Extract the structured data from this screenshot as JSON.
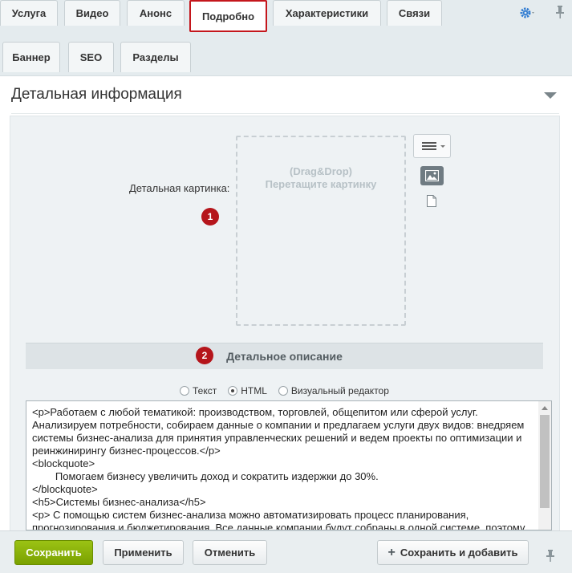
{
  "tabs": [
    {
      "label": "Услуга",
      "active": false
    },
    {
      "label": "Видео",
      "active": false
    },
    {
      "label": "Анонс",
      "active": false
    },
    {
      "label": "Подробно",
      "active": true
    },
    {
      "label": "Характеристики",
      "active": false
    },
    {
      "label": "Связи",
      "active": false
    }
  ],
  "subtabs": [
    {
      "label": "Баннер"
    },
    {
      "label": "SEO"
    },
    {
      "label": "Разделы"
    }
  ],
  "section": {
    "title": "Детальная информация"
  },
  "picture_field": {
    "label": "Детальная картинка:",
    "drop_line1": "(Drag&Drop)",
    "drop_line2": "Перетащите картинку"
  },
  "badges": {
    "one": "1",
    "two": "2"
  },
  "description": {
    "title": "Детальное описание",
    "modes": [
      {
        "label": "Текст",
        "checked": false
      },
      {
        "label": "HTML",
        "checked": true
      },
      {
        "label": "Визуальный редактор",
        "checked": false
      }
    ],
    "content": "<p>Работаем с любой тематикой: производством, торговлей, общепитом или сферой услуг. Анализируем потребности, собираем данные о компании и предлагаем услуги двух видов: внедряем системы бизнес-анализа для принятия управленческих решений и ведем проекты по оптимизации и реинжинирингу бизнес-процессов.</p>\n<blockquote>\n        Помогаем бизнесу увеличить доход и сократить издержки до 30%.\n</blockquote>\n<h5>Системы бизнес-анализа</h5>\n<p> С помощью систем бизнес-анализа можно автоматизировать процесс планирования, прогнозирования и бюджетирования. Все данные компании будут собраны в одной системе, поэтому"
  },
  "footer": {
    "save": "Сохранить",
    "apply": "Применить",
    "cancel": "Отменить",
    "save_add": "Сохранить и добавить"
  },
  "colors": {
    "accent_red": "#c4161c",
    "save_green": "#86ad00",
    "gear_blue": "#2f7bd1"
  },
  "icons": {
    "gear": "gear-icon",
    "pin": "pin-icon",
    "menu": "hamburger-icon",
    "image": "image-icon",
    "file": "file-icon",
    "plus": "plus-icon"
  }
}
